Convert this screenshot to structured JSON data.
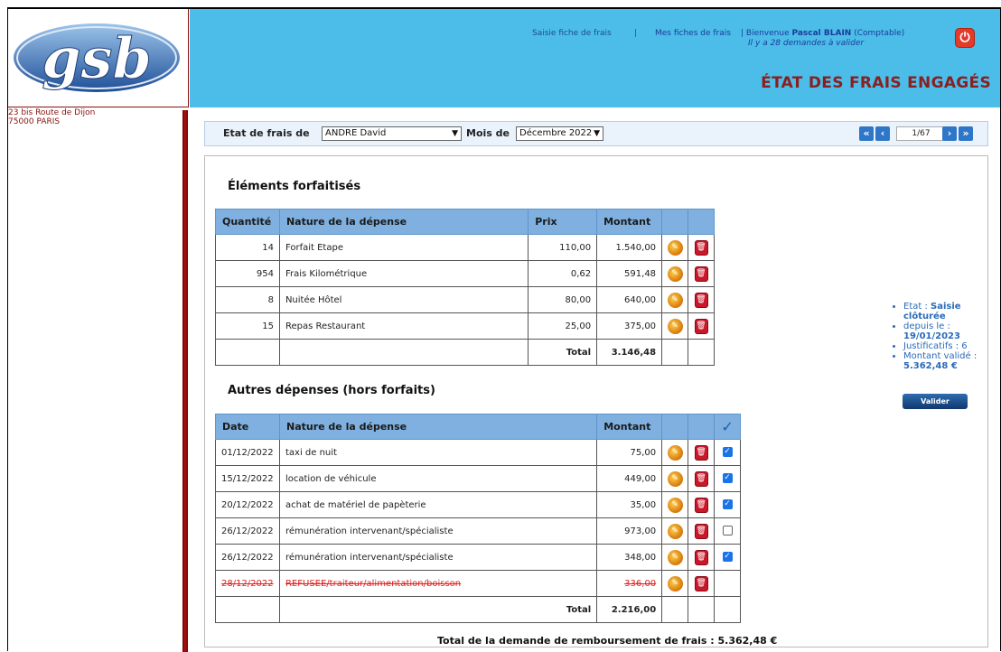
{
  "logo_text": "gsb",
  "address": {
    "line1": "23 bis Route de Dijon",
    "line2": "75000 PARIS"
  },
  "nav": {
    "saisie": "Saisie fiche de frais",
    "separator": "|",
    "mes_fiches": "Mes fiches de frais",
    "welcome_prefix": "| Bienvenue ",
    "welcome_name": "Pascal BLAIN",
    "welcome_role": " (Comptable)",
    "pending": "Il y a 28 demandes à valider"
  },
  "page_title": "ÉTAT DES FRAIS ENGAGÉS",
  "filter": {
    "visiteur_label": "Etat de frais de",
    "visiteur_value": "ANDRE David",
    "mois_label": "Mois de",
    "mois_value": "Décembre 2022",
    "page_indicator": "1/67"
  },
  "forfait": {
    "title": "Éléments forfaitisés",
    "headers": [
      "Quantité",
      "Nature de la dépense",
      "Prix",
      "Montant"
    ],
    "rows": [
      {
        "qte": "14",
        "nature": "Forfait Etape",
        "prix": "110,00",
        "montant": "1.540,00"
      },
      {
        "qte": "954",
        "nature": "Frais Kilométrique",
        "prix": "0,62",
        "montant": "591,48"
      },
      {
        "qte": "8",
        "nature": "Nuitée Hôtel",
        "prix": "80,00",
        "montant": "640,00"
      },
      {
        "qte": "15",
        "nature": "Repas Restaurant",
        "prix": "25,00",
        "montant": "375,00"
      }
    ],
    "total_label": "Total",
    "total_value": "3.146,48"
  },
  "hors_forfait": {
    "title": "Autres dépenses (hors forfaits)",
    "headers": [
      "Date",
      "Nature de la dépense",
      "Montant"
    ],
    "check_icon": "✓",
    "rows": [
      {
        "date": "01/12/2022",
        "nature": "taxi de nuit",
        "montant": "75,00",
        "checked": true,
        "refused": false
      },
      {
        "date": "15/12/2022",
        "nature": "location de véhicule",
        "montant": "449,00",
        "checked": true,
        "refused": false
      },
      {
        "date": "20/12/2022",
        "nature": "achat de matériel de papèterie",
        "montant": "35,00",
        "checked": true,
        "refused": false
      },
      {
        "date": "26/12/2022",
        "nature": "rémunération intervenant/spécialiste",
        "montant": "973,00",
        "checked": false,
        "refused": false
      },
      {
        "date": "26/12/2022",
        "nature": "rémunération intervenant/spécialiste",
        "montant": "348,00",
        "checked": true,
        "refused": false
      },
      {
        "date": "28/12/2022",
        "nature": "REFUSEE/traiteur/alimentation/boisson",
        "montant": "336,00",
        "checked": false,
        "refused": true
      }
    ],
    "total_label": "Total",
    "total_value": "2.216,00"
  },
  "side": {
    "etat_label": "Etat : ",
    "etat_value": "Saisie clôturée",
    "depuis_label": "depuis le :",
    "depuis_value": "19/01/2023",
    "justificatifs": "Justificatifs : 6",
    "montant_label": "Montant validé :",
    "montant_value": "5.362,48 €",
    "valider": "Valider"
  },
  "grand_total": "Total de la demande de remboursement de frais : 5.362,48 €",
  "colors": {
    "header_bg": "#4bbde8",
    "title_red": "#8a1f1f",
    "table_head": "#7fb0df",
    "refused": "#e02020"
  }
}
